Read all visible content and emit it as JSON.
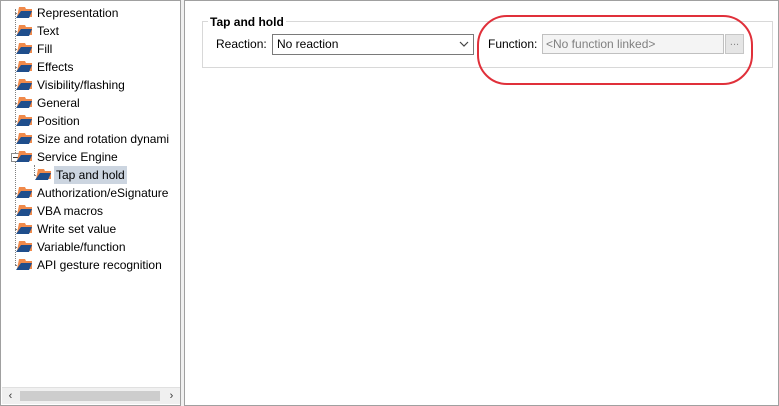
{
  "tree": {
    "items": [
      {
        "label": "Representation"
      },
      {
        "label": "Text"
      },
      {
        "label": "Fill"
      },
      {
        "label": "Effects"
      },
      {
        "label": "Visibility/flashing"
      },
      {
        "label": "General"
      },
      {
        "label": "Position"
      },
      {
        "label": "Size and rotation dynami"
      },
      {
        "label": "Service Engine"
      },
      {
        "label": "Tap and hold"
      },
      {
        "label": "Authorization/eSignature"
      },
      {
        "label": "VBA macros"
      },
      {
        "label": "Write set value"
      },
      {
        "label": "Variable/function"
      },
      {
        "label": "API gesture recognition"
      }
    ],
    "selected": "Tap and hold",
    "scroll_left": "‹",
    "scroll_right": "›"
  },
  "panel": {
    "group_title": "Tap and hold",
    "reaction_label": "Reaction:",
    "reaction_value": "No reaction",
    "function_label": "Function:",
    "function_placeholder": "<No function linked>",
    "function_button": "..."
  },
  "colors": {
    "folder_orange": "#f08a4b",
    "folder_blue": "#1f4e8c",
    "selection": "#ccd5e0",
    "annotation": "#e0303a"
  }
}
